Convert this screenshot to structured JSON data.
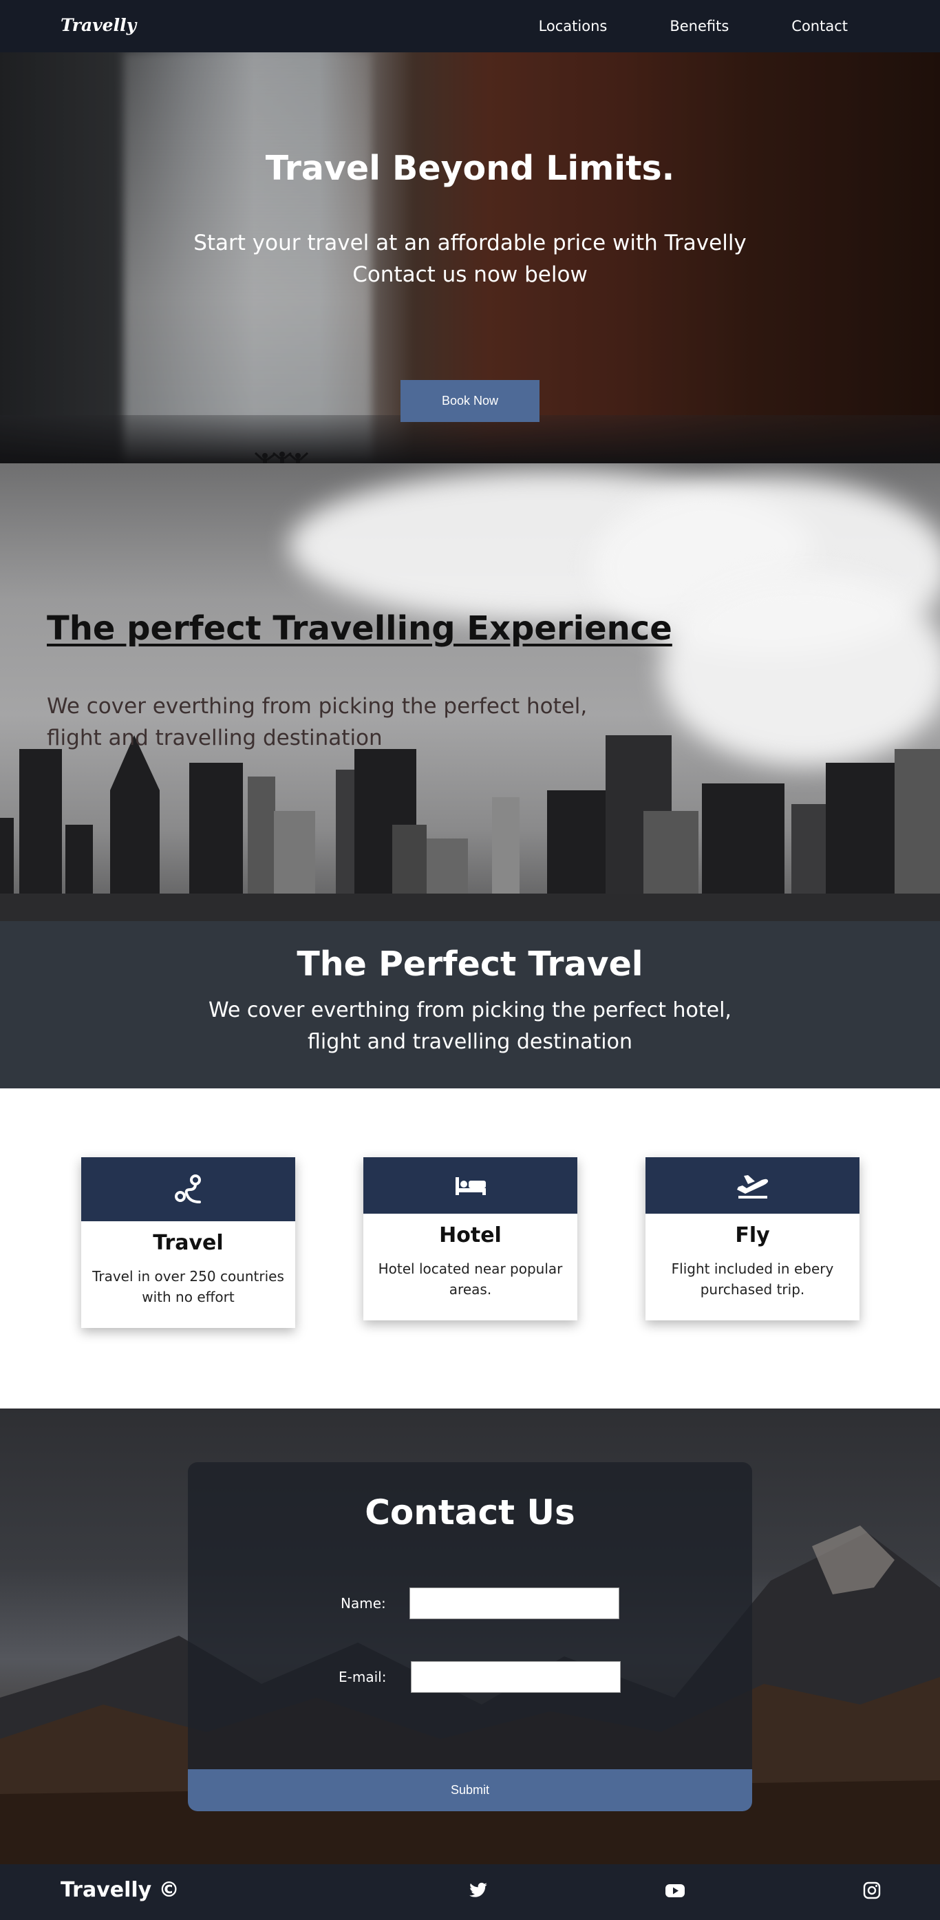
{
  "nav": {
    "logo": "Travelly",
    "links": [
      "Locations",
      "Benefits",
      "Contact"
    ]
  },
  "hero": {
    "title": "Travel Beyond Limits.",
    "subtitle_line1": "Start your travel at an affordable price with Travelly",
    "subtitle_line2": "Contact us now below",
    "button": "Book Now"
  },
  "experience": {
    "title": "The perfect Travelling Experience",
    "text_line1": "We cover everthing from picking the perfect hotel,",
    "text_line2": "flight and travelling destination"
  },
  "band": {
    "title": "The Perfect Travel",
    "text_line1": "We cover everthing from picking the perfect hotel,",
    "text_line2": "flight and travelling destination"
  },
  "features": [
    {
      "icon": "route-icon",
      "title": "Travel",
      "text": "Travel in over 250 countries with no effort"
    },
    {
      "icon": "bed-icon",
      "title": "Hotel",
      "text": "Hotel located near popular areas."
    },
    {
      "icon": "plane-departure-icon",
      "title": "Fly",
      "text": "Flight included in ebery purchased trip."
    }
  ],
  "contact": {
    "title": "Contact Us",
    "name_label": "Name:",
    "email_label": "E-mail:",
    "name_value": "",
    "email_value": "",
    "submit": "Submit"
  },
  "footer": {
    "brand": "Travelly ©",
    "social": [
      "twitter-icon",
      "youtube-icon",
      "instagram-icon"
    ]
  },
  "colors": {
    "nav_bg": "#161b26",
    "button_blue": "#4e6a97",
    "band_bg": "#31373f",
    "card_header": "#243350",
    "footer_bg": "#1c212c"
  }
}
